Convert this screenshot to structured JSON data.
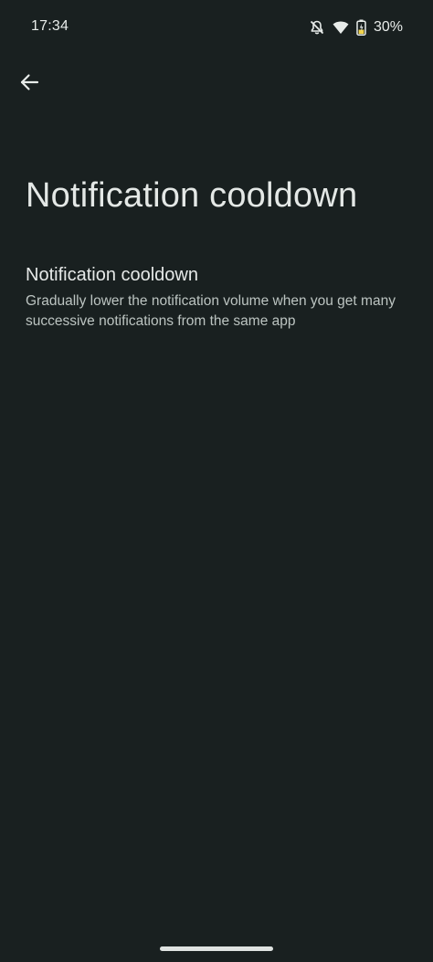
{
  "status_bar": {
    "time": "17:34",
    "battery_percent": "30%",
    "icons": [
      "muted-notification-icon",
      "wifi-icon",
      "battery-charging-icon"
    ]
  },
  "toolbar": {
    "back_icon": "arrow-back-icon"
  },
  "page": {
    "title": "Notification cooldown"
  },
  "setting": {
    "title": "Notification cooldown",
    "summary": "Gradually lower the notification volume when you get many successive notifications from the same app"
  },
  "colors": {
    "background": "#192020",
    "primary_text": "#e4e8e6",
    "secondary_text": "#bcc4c1",
    "battery_fill": "#f2d34a"
  }
}
